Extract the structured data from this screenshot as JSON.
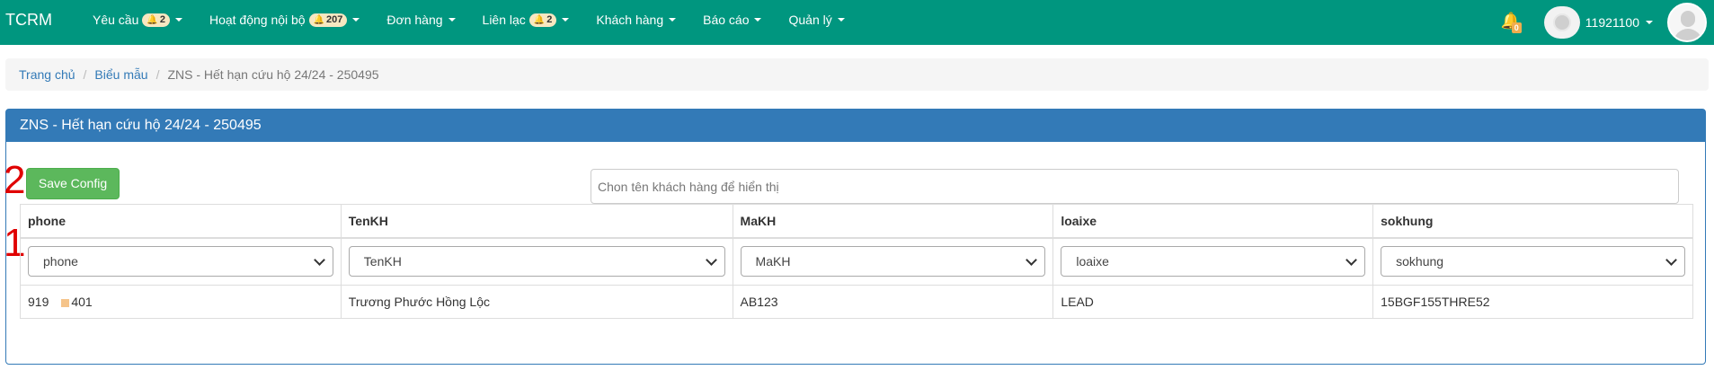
{
  "app": {
    "brand": "TCRM"
  },
  "nav": {
    "items": [
      {
        "label": "Yêu cầu",
        "badge": "2"
      },
      {
        "label": "Hoạt động nội bộ",
        "badge": "207"
      },
      {
        "label": "Đơn hàng"
      },
      {
        "label": "Liên lạc",
        "badge": "2"
      },
      {
        "label": "Khách hàng"
      },
      {
        "label": "Báo cáo"
      },
      {
        "label": "Quản lý"
      }
    ],
    "notification_count": "0",
    "username": "11921100"
  },
  "breadcrumb": {
    "home": "Trang chủ",
    "templates": "Biểu mẫu",
    "current": "ZNS - Hết hạn cứu hộ 24/24 - 250495"
  },
  "panel": {
    "title": "ZNS - Hết hạn cứu hộ 24/24 - 250495",
    "save_label": "Save Config",
    "display_placeholder": "Chon tên khách hàng để hiển thị",
    "markers": [
      "2",
      "1"
    ]
  },
  "table": {
    "columns": [
      "phone",
      "TenKH",
      "MaKH",
      "loaixe",
      "sokhung"
    ],
    "filters": [
      "phone",
      "TenKH",
      "MaKH",
      "loaixe",
      "sokhung"
    ],
    "row": {
      "phone_start": "919",
      "phone_end": "401",
      "TenKH": "Trương Phước Hồng Lộc",
      "MaKH": "AB123",
      "loaixe": "LEAD",
      "sokhung": "15BGF155THRE52"
    }
  },
  "colors": {
    "navbar": "#00967f",
    "panel_heading": "#337ab7",
    "save_button": "#5cb85c",
    "marker": "#e00000",
    "badge_bg": "#f7e7c1"
  }
}
